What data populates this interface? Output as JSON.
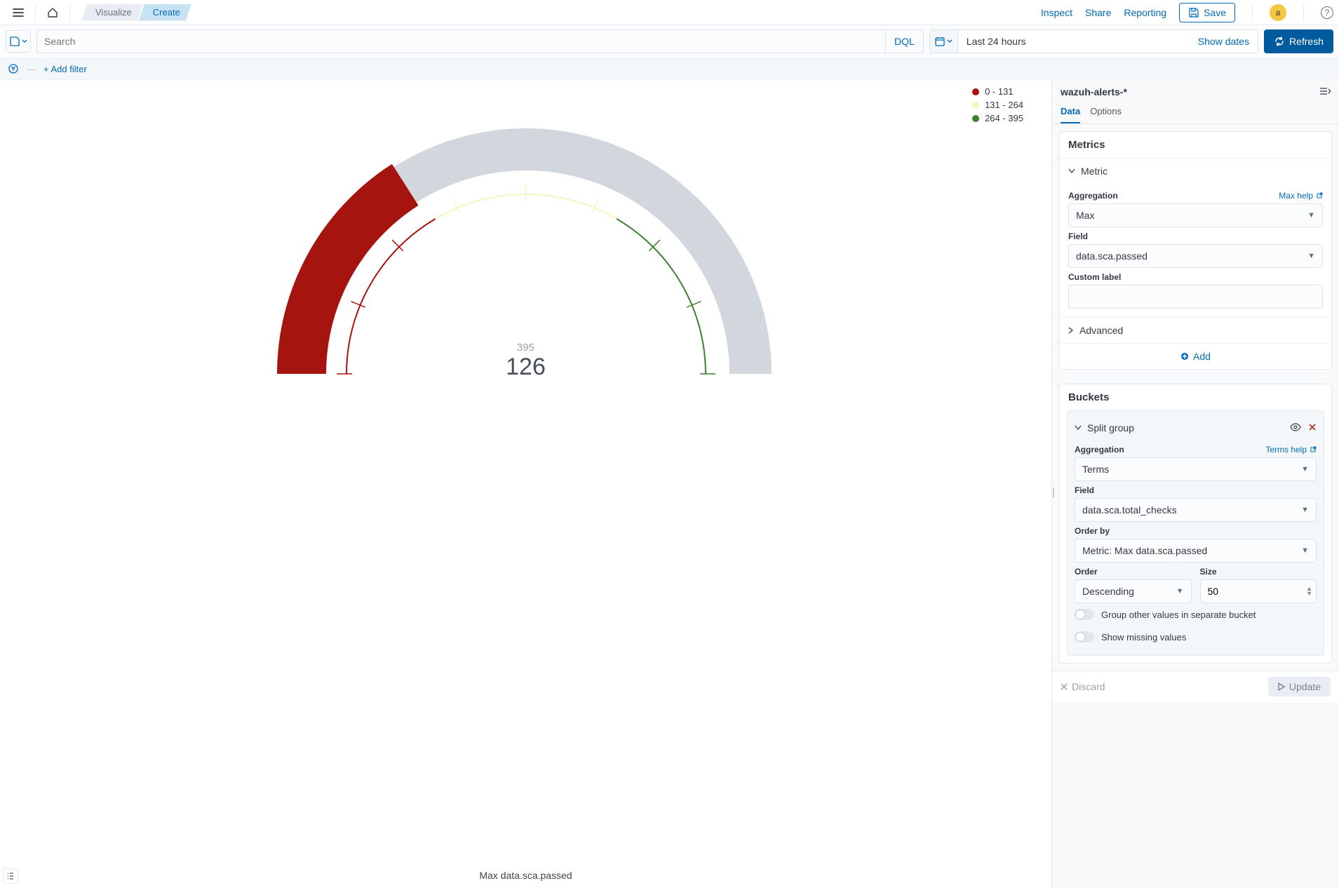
{
  "topbar": {
    "breadcrumb_visualize": "Visualize",
    "breadcrumb_create": "Create",
    "inspect": "Inspect",
    "share": "Share",
    "reporting": "Reporting",
    "save": "Save",
    "avatar_initial": "a"
  },
  "querybar": {
    "search_placeholder": "Search",
    "dql": "DQL",
    "date_range": "Last 24 hours",
    "show_dates": "Show dates",
    "refresh": "Refresh"
  },
  "filterbar": {
    "add_filter": "+ Add filter"
  },
  "legend": [
    {
      "color": "#a5140f",
      "label": "0 - 131"
    },
    {
      "color": "#f8f4bf",
      "label": "131 - 264"
    },
    {
      "color": "#3f7f32",
      "label": "264 - 395"
    }
  ],
  "gauge": {
    "max_label": "395",
    "value_label": "126",
    "axis_title": "Max data.sca.passed"
  },
  "sidepanel": {
    "index_pattern": "wazuh-alerts-*",
    "tabs": {
      "data": "Data",
      "options": "Options"
    },
    "metrics": {
      "heading": "Metrics",
      "item_title": "Metric",
      "agg_label": "Aggregation",
      "agg_help": "Max help",
      "agg_value": "Max",
      "field_label": "Field",
      "field_value": "data.sca.passed",
      "custom_label": "Custom label",
      "custom_value": "",
      "advanced": "Advanced",
      "add": "Add"
    },
    "buckets": {
      "heading": "Buckets",
      "item_title": "Split group",
      "agg_label": "Aggregation",
      "agg_help": "Terms help",
      "agg_value": "Terms",
      "field_label": "Field",
      "field_value": "data.sca.total_checks",
      "orderby_label": "Order by",
      "orderby_value": "Metric: Max data.sca.passed",
      "order_label": "Order",
      "order_value": "Descending",
      "size_label": "Size",
      "size_value": "50",
      "group_other": "Group other values in separate bucket",
      "show_missing": "Show missing values"
    },
    "footer": {
      "discard": "Discard",
      "update": "Update"
    }
  },
  "chart_data": {
    "type": "gauge",
    "value": 126,
    "max": 395,
    "ranges": [
      {
        "from": 0,
        "to": 131,
        "color": "#a5140f"
      },
      {
        "from": 131,
        "to": 264,
        "color": "#f8f4bf"
      },
      {
        "from": 264,
        "to": 395,
        "color": "#3f7f32"
      }
    ],
    "title": "Max data.sca.passed",
    "arc_start_deg": 180,
    "arc_end_deg": 0,
    "track_color": "#d2d6dd",
    "needle_color": "#a5140f"
  }
}
